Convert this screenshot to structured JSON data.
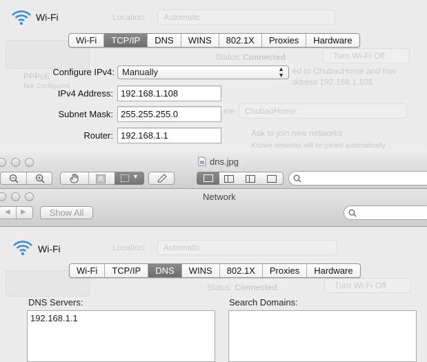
{
  "top_panel": {
    "title": "Wi-Fi",
    "tabs": [
      {
        "label": "Wi-Fi",
        "selected": false
      },
      {
        "label": "TCP/IP",
        "selected": true
      },
      {
        "label": "DNS",
        "selected": false
      },
      {
        "label": "WINS",
        "selected": false
      },
      {
        "label": "802.1X",
        "selected": false
      },
      {
        "label": "Proxies",
        "selected": false
      },
      {
        "label": "Hardware",
        "selected": false
      }
    ],
    "configure_label": "Configure IPv4:",
    "configure_value": "Manually",
    "ipv4_label": "IPv4 Address:",
    "ipv4_value": "192.168.1.108",
    "subnet_label": "Subnet Mask:",
    "subnet_value": "255.255.255.0",
    "router_label": "Router:",
    "router_value": "192.168.1.1",
    "background_text": {
      "location_label": "Location:",
      "location_value": "Automatic",
      "status_label": "Status:",
      "status_value": "Connected",
      "turn_off": "Turn Wi-Fi Off",
      "status_detail_1": "ed to ChubaoHome and has",
      "status_detail_2": "ddress 192.168.1.108.",
      "network_label": "me:",
      "network_value": "ChubaoHome",
      "ask_join": "Ask to join new networks",
      "known": "Known networks will be joined automatically",
      "pppoe": "PPPoE",
      "not_configured": "Not Configured"
    }
  },
  "preview_window": {
    "filename": "dns.jpg"
  },
  "network_window": {
    "title": "Network",
    "show_all": "Show All"
  },
  "bottom_panel": {
    "title": "Wi-Fi",
    "tabs": [
      {
        "label": "Wi-Fi",
        "selected": false
      },
      {
        "label": "TCP/IP",
        "selected": false
      },
      {
        "label": "DNS",
        "selected": true
      },
      {
        "label": "WINS",
        "selected": false
      },
      {
        "label": "802.1X",
        "selected": false
      },
      {
        "label": "Proxies",
        "selected": false
      },
      {
        "label": "Hardware",
        "selected": false
      }
    ],
    "dns_servers_label": "DNS Servers:",
    "dns_servers": [
      "192.168.1.1"
    ],
    "search_domains_label": "Search Domains:",
    "background_text": {
      "location_label": "Location:",
      "location_value": "Automatic",
      "status_label": "Status:",
      "status_value": "Connected",
      "turn_off": "Turn Wi-Fi Off",
      "status_detail_1": "ed to ChubaoHome and has",
      "status_detail_2": "ddress 192.168.1.108."
    }
  },
  "colors": {
    "selected_tab": "#767676",
    "wifi_icon": "#3a8fd9",
    "window_bg": "#ececec"
  }
}
